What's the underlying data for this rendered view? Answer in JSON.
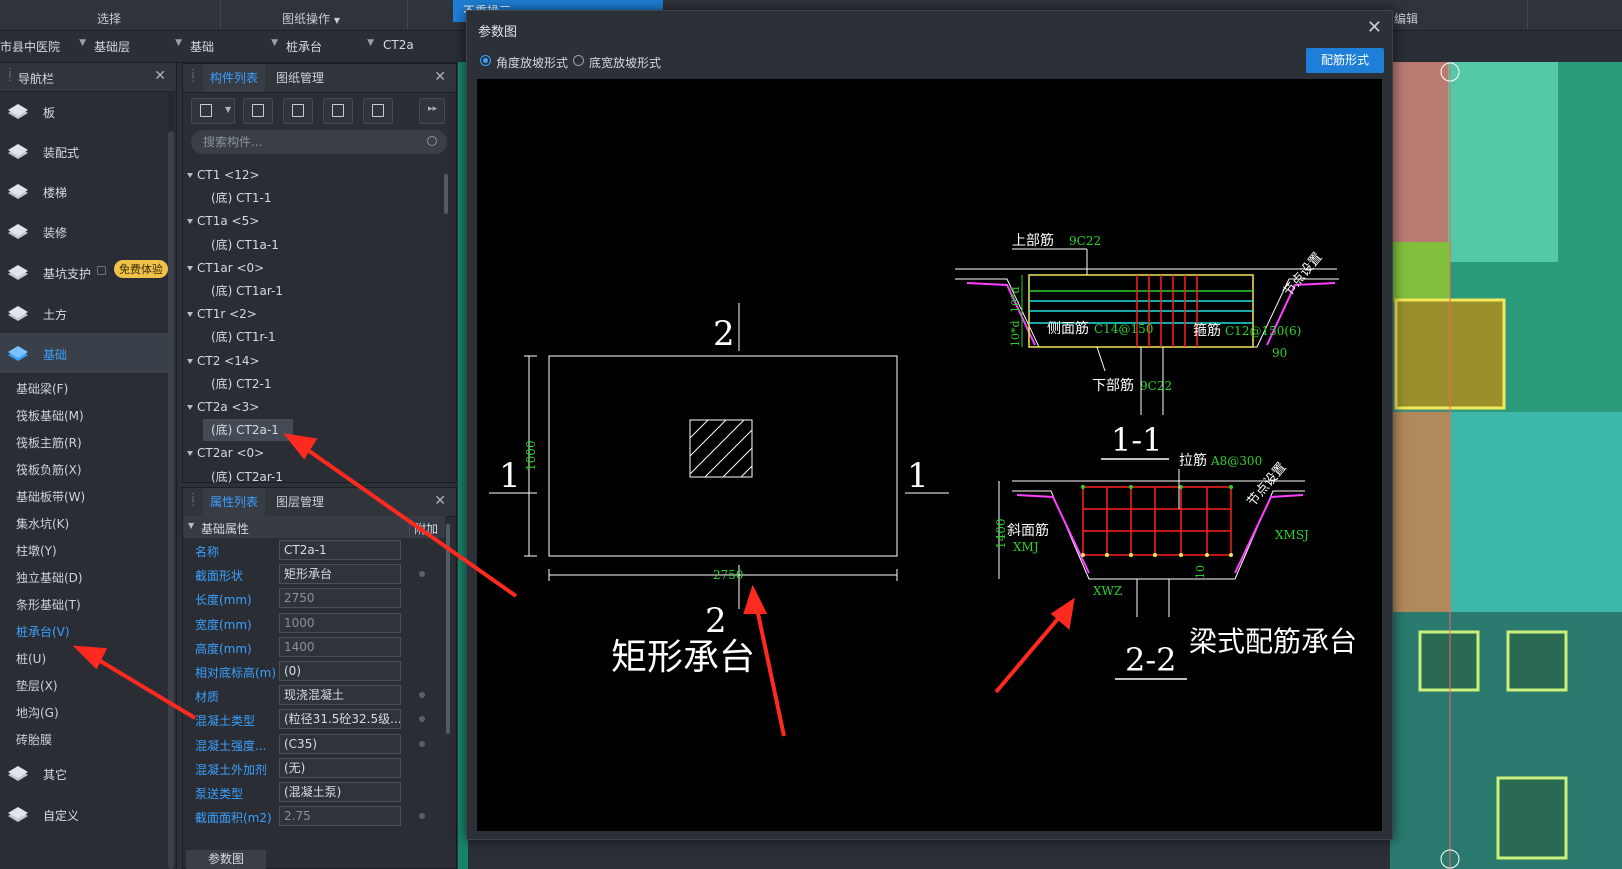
{
  "ribbon": {
    "select_label": "选择",
    "drawing_ops_label": "图纸操作",
    "blue_label": "不重操三",
    "edit_label": "编辑"
  },
  "selectors": {
    "project": "市县中医院",
    "layer": "基础层",
    "category": "基础",
    "type": "桩承台",
    "name": "CT2a"
  },
  "nav": {
    "title": "导航栏",
    "categories": [
      {
        "label": "板",
        "icon": "slab-icon"
      },
      {
        "label": "装配式",
        "icon": "prefab-icon"
      },
      {
        "label": "楼梯",
        "icon": "stair-icon"
      },
      {
        "label": "装修",
        "icon": "decoration-icon"
      },
      {
        "label": "基坑支护",
        "icon": "pit-support-icon",
        "badge": "免费体验"
      },
      {
        "label": "土方",
        "icon": "earthwork-icon"
      },
      {
        "label": "基础",
        "icon": "foundation-icon"
      }
    ],
    "sub_items": [
      "基础梁(F)",
      "筏板基础(M)",
      "筏板主筋(R)",
      "筏板负筋(X)",
      "基础板带(W)",
      "集水坑(K)",
      "柱墩(Y)",
      "独立基础(D)",
      "条形基础(T)",
      "桩承台(V)",
      "桩(U)",
      "垫层(X)",
      "地沟(G)",
      "砖胎膜"
    ],
    "bottom_categories": [
      {
        "label": "其它",
        "icon": "other-icon"
      },
      {
        "label": "自定义",
        "icon": "custom-icon"
      }
    ]
  },
  "component_panel": {
    "tab_list": "构件列表",
    "tab_drawing": "图纸管理",
    "search_placeholder": "搜索构件...",
    "tree": [
      {
        "type": "parent",
        "label": "CT1 <12>"
      },
      {
        "type": "child",
        "label": "(底) CT1-1"
      },
      {
        "type": "parent",
        "label": "CT1a <5>"
      },
      {
        "type": "child",
        "label": "(底) CT1a-1"
      },
      {
        "type": "parent",
        "label": "CT1ar <0>"
      },
      {
        "type": "child",
        "label": "(底) CT1ar-1"
      },
      {
        "type": "parent",
        "label": "CT1r <2>"
      },
      {
        "type": "child",
        "label": "(底) CT1r-1"
      },
      {
        "type": "parent",
        "label": "CT2 <14>"
      },
      {
        "type": "child",
        "label": "(底) CT2-1"
      },
      {
        "type": "parent",
        "label": "CT2a <3>"
      },
      {
        "type": "child",
        "label": "(底) CT2a-1"
      },
      {
        "type": "parent",
        "label": "CT2ar <0>"
      },
      {
        "type": "child",
        "label": "(底) CT2ar-1"
      }
    ]
  },
  "property_panel": {
    "tab_props": "属性列表",
    "tab_layers": "图层管理",
    "group": "基础属性",
    "extra_col": "附加",
    "rows": [
      {
        "k": "名称",
        "v": "CT2a-1"
      },
      {
        "k": "截面形状",
        "v": "矩形承台"
      },
      {
        "k": "长度(mm)",
        "v": "2750"
      },
      {
        "k": "宽度(mm)",
        "v": "1000"
      },
      {
        "k": "高度(mm)",
        "v": "1400"
      },
      {
        "k": "相对底标高(m)",
        "v": "(0)"
      },
      {
        "k": "材质",
        "v": "现浇混凝土"
      },
      {
        "k": "混凝土类型",
        "v": "(粒径31.5砼32.5级..."
      },
      {
        "k": "混凝土强度...",
        "v": "(C35)"
      },
      {
        "k": "混凝土外加剂",
        "v": "(无)"
      },
      {
        "k": "泵送类型",
        "v": "(混凝土泵)"
      },
      {
        "k": "截面面积(m2)",
        "v": "2.75"
      }
    ]
  },
  "bottom_tab": "参数图",
  "dialog": {
    "title": "参数图",
    "radio_angle": "角度放坡形式",
    "radio_width": "底宽放坡形式",
    "btn": "配筋形式",
    "cad": {
      "left_title": "矩形承台",
      "right_title": "梁式配筋承台",
      "sec1": "1-1",
      "sec2": "2-2",
      "mark1": "1",
      "mark2": "2",
      "dim_len": "2750",
      "dim_wid": "1000",
      "dim_h": "1400",
      "top_bar_label": "上部筋",
      "top_bar_val": "9C22",
      "side_bar_label": "侧面筋",
      "side_bar_val": "C14@150",
      "stirrup_label": "箍筋",
      "stirrup_val": "C12@150(6)",
      "bottom_bar_label": "下部筋",
      "bottom_bar_val": "9C22",
      "node_label": "节点设置",
      "tie_label": "拉筋",
      "tie_val": "A8@300",
      "slope_side_label": "斜面筋",
      "xmj": "XMJ",
      "xmsj": "XMSJ",
      "xwz": "XWZ",
      "angle": "90",
      "ten_d": "10*d",
      "ten": "10"
    }
  },
  "colors": {
    "accent": "#3aa0ff",
    "button": "#1f7fd8",
    "cad_green": "#2bd12b",
    "cad_red": "#ff2020",
    "arrow_red": "#ff2a1f"
  }
}
